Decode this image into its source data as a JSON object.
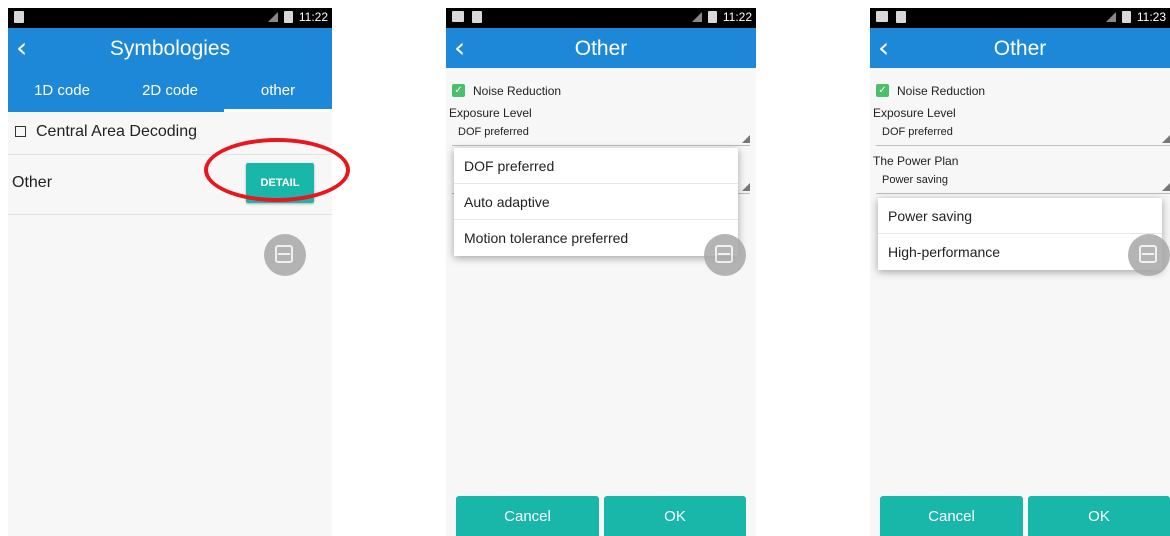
{
  "screens": [
    {
      "status": {
        "time": "11:22"
      },
      "appbar": {
        "title": "Symbologies"
      },
      "tabs": [
        {
          "label": "1D code",
          "active": false
        },
        {
          "label": "2D code",
          "active": false
        },
        {
          "label": "other",
          "active": true
        }
      ],
      "central_area": {
        "label": "Central Area Decoding",
        "checked": false
      },
      "other_row": {
        "label": "Other",
        "button": "DETAIL"
      }
    },
    {
      "status": {
        "time": "11:22"
      },
      "appbar": {
        "title": "Other"
      },
      "noise_reduction": {
        "label": "Noise Reduction",
        "checked": true
      },
      "exposure": {
        "label": "Exposure Level",
        "value": "DOF preferred"
      },
      "dropdown": [
        "DOF preferred",
        "Auto adaptive",
        "Motion tolerance preferred"
      ],
      "buttons": {
        "cancel": "Cancel",
        "ok": "OK"
      }
    },
    {
      "status": {
        "time": "11:23"
      },
      "appbar": {
        "title": "Other"
      },
      "noise_reduction": {
        "label": "Noise Reduction",
        "checked": true
      },
      "exposure": {
        "label": "Exposure Level",
        "value": "DOF preferred"
      },
      "power_plan": {
        "label": "The Power Plan",
        "value": "Power saving"
      },
      "dropdown": [
        "Power saving",
        "High-performance"
      ],
      "buttons": {
        "cancel": "Cancel",
        "ok": "OK"
      }
    }
  ],
  "colors": {
    "appbar": "#1e88d8",
    "accent_button": "#19b7a9",
    "highlight_circle": "#e8161d",
    "checkbox": "#4cbf6a"
  }
}
